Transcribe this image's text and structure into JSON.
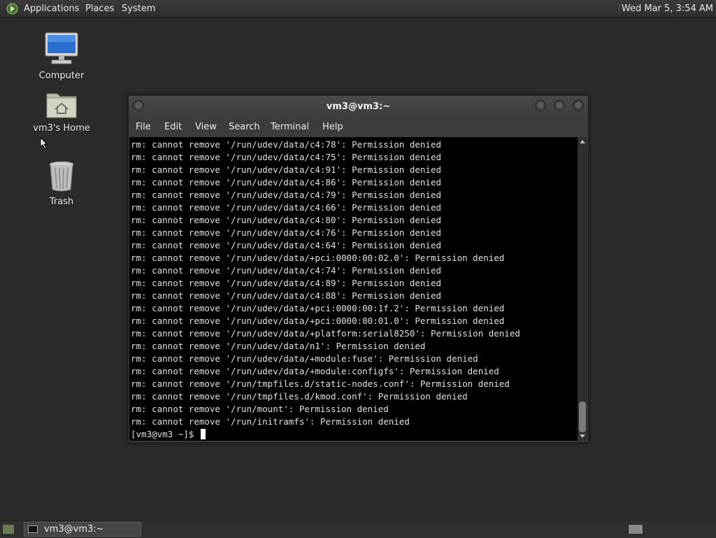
{
  "top_panel": {
    "menus": [
      "Applications",
      "Places",
      "System"
    ],
    "clock": "Wed Mar  5,  3:54 AM"
  },
  "desktop": {
    "icons": [
      {
        "label": "Computer",
        "icon": "computer-icon"
      },
      {
        "label": "vm3's Home",
        "icon": "home-folder-icon"
      },
      {
        "label": "Trash",
        "icon": "trash-icon"
      }
    ]
  },
  "window": {
    "title": "vm3@vm3:~",
    "menus": [
      "File",
      "Edit",
      "View",
      "Search",
      "Terminal",
      "Help"
    ],
    "lines": [
      "rm: cannot remove '/run/udev/data/c4:78': Permission denied",
      "rm: cannot remove '/run/udev/data/c4:75': Permission denied",
      "rm: cannot remove '/run/udev/data/c4:91': Permission denied",
      "rm: cannot remove '/run/udev/data/c4:86': Permission denied",
      "rm: cannot remove '/run/udev/data/c4:79': Permission denied",
      "rm: cannot remove '/run/udev/data/c4:66': Permission denied",
      "rm: cannot remove '/run/udev/data/c4:80': Permission denied",
      "rm: cannot remove '/run/udev/data/c4:76': Permission denied",
      "rm: cannot remove '/run/udev/data/c4:64': Permission denied",
      "rm: cannot remove '/run/udev/data/+pci:0000:00:02.0': Permission denied",
      "rm: cannot remove '/run/udev/data/c4:74': Permission denied",
      "rm: cannot remove '/run/udev/data/c4:89': Permission denied",
      "rm: cannot remove '/run/udev/data/c4:88': Permission denied",
      "rm: cannot remove '/run/udev/data/+pci:0000:00:1f.2': Permission denied",
      "rm: cannot remove '/run/udev/data/+pci:0000:00:01.0': Permission denied",
      "rm: cannot remove '/run/udev/data/+platform:serial8250': Permission denied",
      "rm: cannot remove '/run/udev/data/n1': Permission denied",
      "rm: cannot remove '/run/udev/data/+module:fuse': Permission denied",
      "rm: cannot remove '/run/udev/data/+module:configfs': Permission denied",
      "rm: cannot remove '/run/tmpfiles.d/static-nodes.conf': Permission denied",
      "rm: cannot remove '/run/tmpfiles.d/kmod.conf': Permission denied",
      "rm: cannot remove '/run/mount': Permission denied",
      "rm: cannot remove '/run/initramfs': Permission denied"
    ],
    "prompt": "[vm3@vm3 ~]$ "
  },
  "bottom_panel": {
    "task_label": "vm3@vm3:~"
  },
  "colors": {
    "desktop_bg": "#2b2b2b",
    "terminal_bg": "#000000",
    "terminal_fg": "#e0e0e0"
  }
}
